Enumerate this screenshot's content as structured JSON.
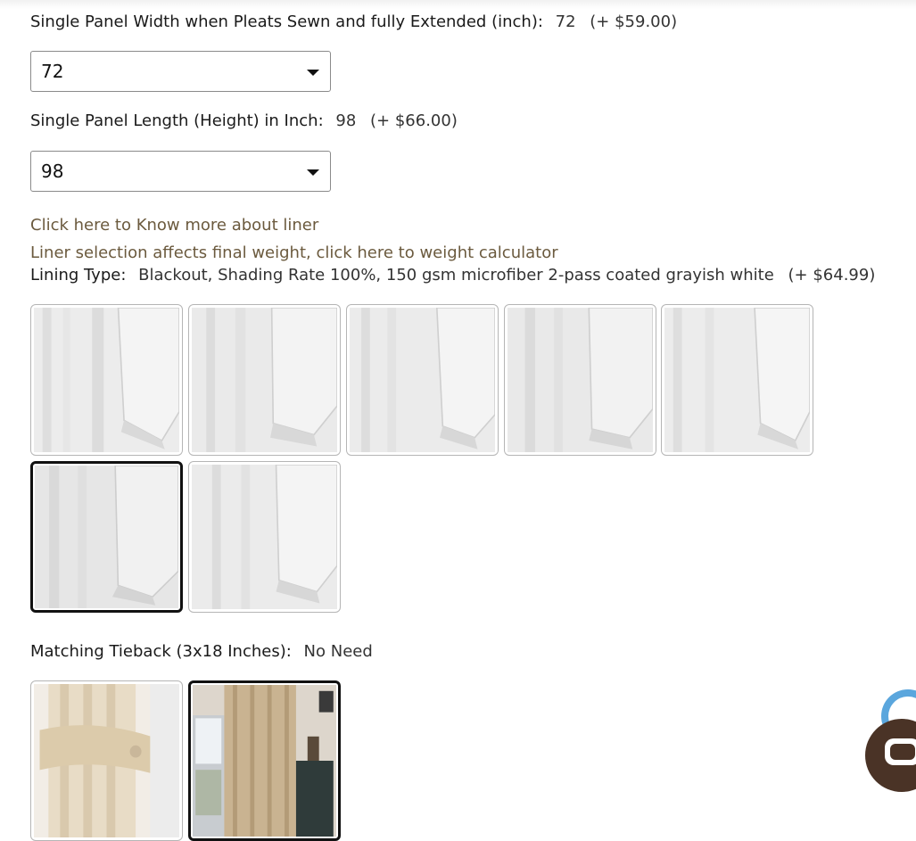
{
  "width_option": {
    "label": "Single Panel Width when Pleats Sewn and fully Extended (inch):",
    "value": "72",
    "price": "(+ $59.00)",
    "select_value": "72"
  },
  "length_option": {
    "label": "Single Panel Length (Height) in Inch:",
    "value": "98",
    "price": "(+ $66.00)",
    "select_value": "98"
  },
  "links": {
    "liner_info": "Click here to Know more about liner",
    "weight_calc": "Liner selection affects final weight, click here to weight calculator"
  },
  "lining": {
    "label": "Lining Type:",
    "value": "Blackout, Shading Rate 100%, 150 gsm microfiber 2-pass coated grayish white",
    "price": "(+ $64.99)",
    "swatch_count": 7,
    "selected_index": 5
  },
  "tieback": {
    "label": "Matching Tieback (3x18 Inches):",
    "value": "No Need",
    "selected_index": 1
  },
  "colors": {
    "fabric": "#e3e3e3",
    "fold_shadow": "#cfcfcf",
    "link": "#6b5a3e",
    "chat_blue": "#5aa6dd",
    "chat_brown": "#4a3326"
  },
  "icons": {
    "select_caret": "chevron-down-icon",
    "chat": "chat-bubble-icon"
  }
}
